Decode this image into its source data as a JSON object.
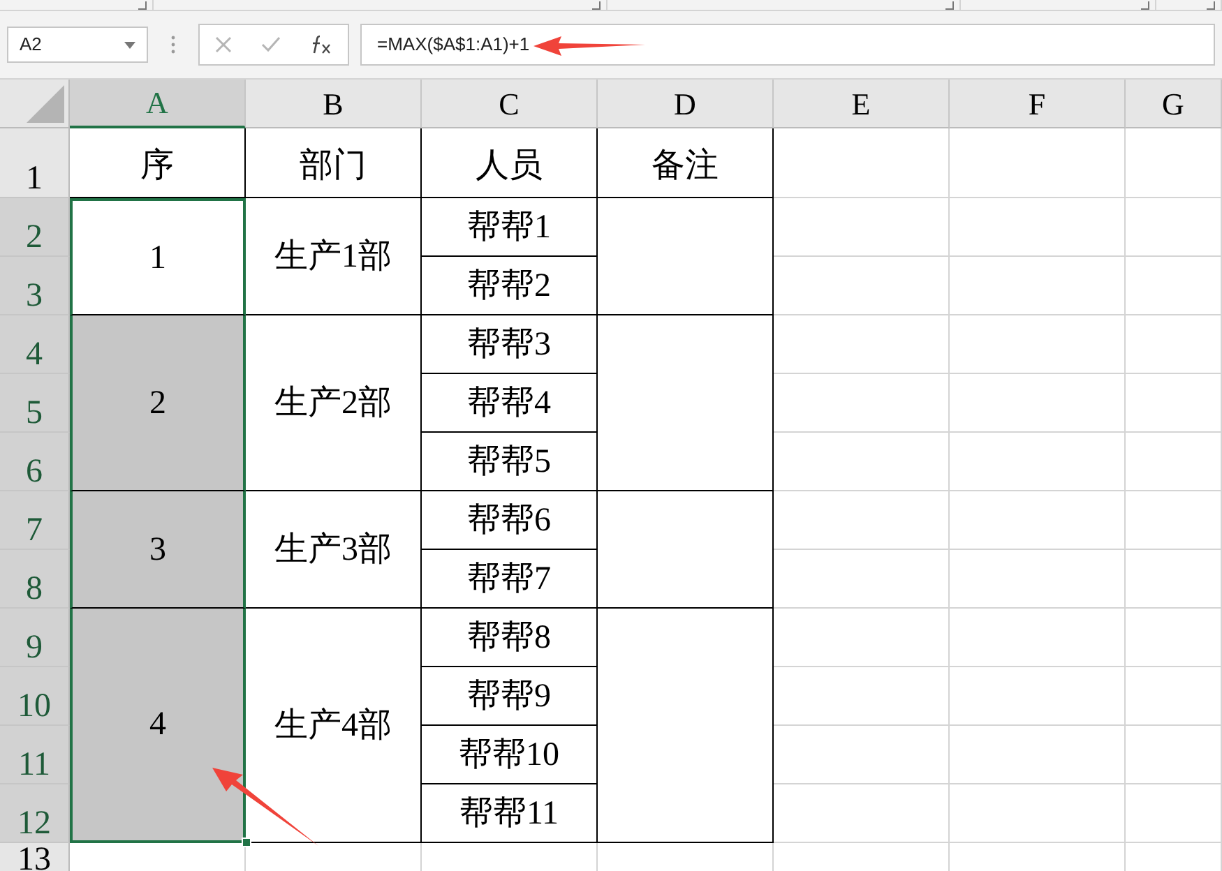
{
  "formula_bar": {
    "name_box": "A2",
    "formula": "=MAX($A$1:A1)+1"
  },
  "columns": [
    {
      "label": "A",
      "selected": true
    },
    {
      "label": "B",
      "selected": false
    },
    {
      "label": "C",
      "selected": false
    },
    {
      "label": "D",
      "selected": false
    },
    {
      "label": "E",
      "selected": false
    },
    {
      "label": "F",
      "selected": false
    },
    {
      "label": "G",
      "selected": false
    }
  ],
  "rows": [
    {
      "label": "1",
      "selected": false
    },
    {
      "label": "2",
      "selected": true
    },
    {
      "label": "3",
      "selected": true
    },
    {
      "label": "4",
      "selected": true
    },
    {
      "label": "5",
      "selected": true
    },
    {
      "label": "6",
      "selected": true
    },
    {
      "label": "7",
      "selected": true
    },
    {
      "label": "8",
      "selected": true
    },
    {
      "label": "9",
      "selected": true
    },
    {
      "label": "10",
      "selected": true
    },
    {
      "label": "11",
      "selected": true
    },
    {
      "label": "12",
      "selected": true
    },
    {
      "label": "13",
      "selected": false
    }
  ],
  "header": [
    "序",
    "部门",
    "人员",
    "备注"
  ],
  "groups": [
    {
      "seq": "1",
      "highlighted": false,
      "dept": "生产1部",
      "people": [
        "帮帮1",
        "帮帮2"
      ]
    },
    {
      "seq": "2",
      "highlighted": true,
      "dept": "生产2部",
      "people": [
        "帮帮3",
        "帮帮4",
        "帮帮5"
      ]
    },
    {
      "seq": "3",
      "highlighted": true,
      "dept": "生产3部",
      "people": [
        "帮帮6",
        "帮帮7"
      ]
    },
    {
      "seq": "4",
      "highlighted": true,
      "dept": "生产4部",
      "people": [
        "帮帮8",
        "帮帮9",
        "帮帮10",
        "帮帮11"
      ]
    }
  ]
}
